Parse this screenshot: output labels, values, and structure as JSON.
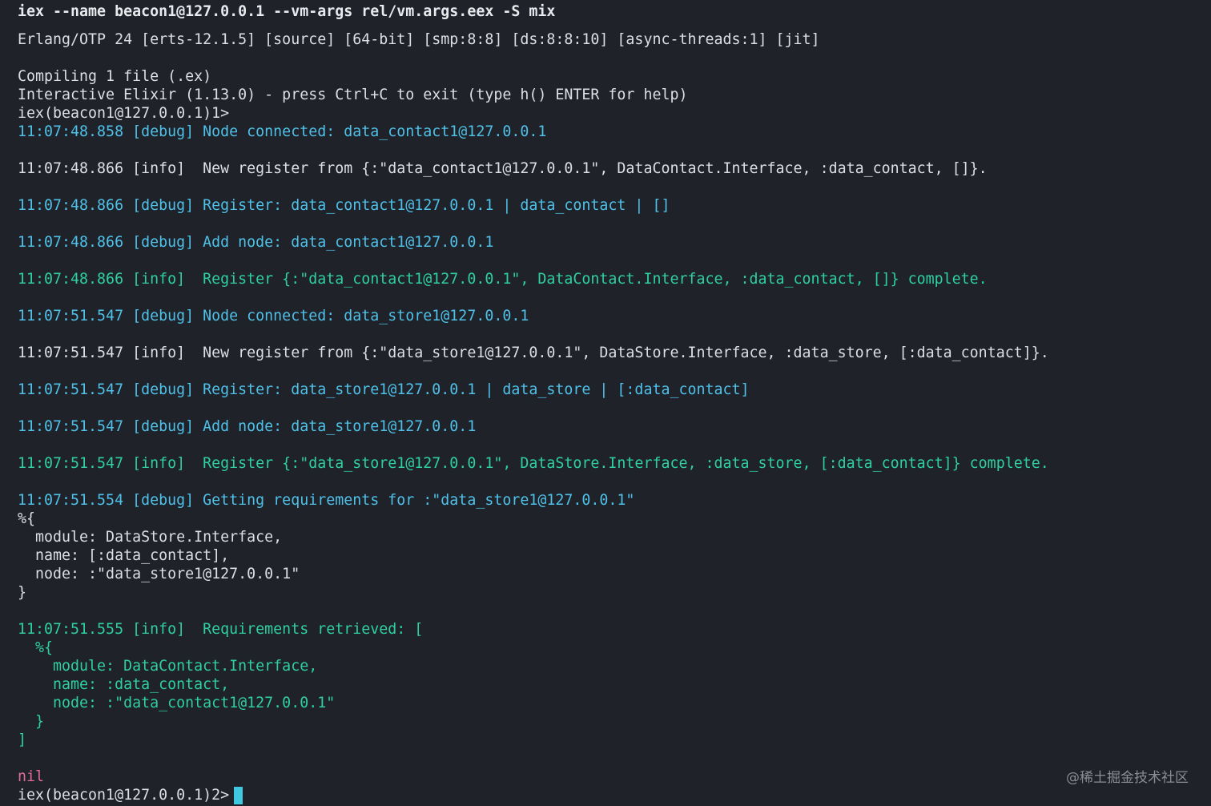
{
  "terminal": {
    "command": "iex --name beacon1@127.0.0.1 --vm-args rel/vm.args.eex -S mix",
    "lines": [
      "Erlang/OTP 24 [erts-12.1.5] [source] [64-bit] [smp:8:8] [ds:8:8:10] [async-threads:1] [jit]",
      "Compiling 1 file (.ex)",
      "Interactive Elixir (1.13.0) - press Ctrl+C to exit (type h() ENTER for help)",
      "iex(beacon1@127.0.0.1)1>",
      "11:07:48.858 [debug] Node connected: data_contact1@127.0.0.1",
      "11:07:48.866 [info]  New register from {:\"data_contact1@127.0.0.1\", DataContact.Interface, :data_contact, []}.",
      "11:07:48.866 [debug] Register: data_contact1@127.0.0.1 | data_contact | []",
      "11:07:48.866 [debug] Add node: data_contact1@127.0.0.1",
      "11:07:48.866 [info]  Register {:\"data_contact1@127.0.0.1\", DataContact.Interface, :data_contact, []} complete.",
      "11:07:51.547 [debug] Node connected: data_store1@127.0.0.1",
      "11:07:51.547 [info]  New register from {:\"data_store1@127.0.0.1\", DataStore.Interface, :data_store, [:data_contact]}.",
      "11:07:51.547 [debug] Register: data_store1@127.0.0.1 | data_store | [:data_contact]",
      "11:07:51.547 [debug] Add node: data_store1@127.0.0.1",
      "11:07:51.547 [info]  Register {:\"data_store1@127.0.0.1\", DataStore.Interface, :data_store, [:data_contact]} complete.",
      "11:07:51.554 [debug] Getting requirements for :\"data_store1@127.0.0.1\"",
      "%{",
      "  module: DataStore.Interface,",
      "  name: [:data_contact],",
      "  node: :\"data_store1@127.0.0.1\"",
      "}",
      "11:07:51.555 [info]  Requirements retrieved: [",
      "  %{",
      "    module: DataContact.Interface,",
      "    name: :data_contact,",
      "    node: :\"data_contact1@127.0.0.1\"",
      "  }",
      "]",
      "nil",
      "iex(beacon1@127.0.0.1)2> "
    ]
  },
  "watermark": "@稀土掘金技术社区",
  "colors": {
    "background": "#1f2229",
    "plain": "#dcdfe4",
    "debug": "#4fc1e9",
    "info": "#2fd0a0",
    "nil": "#e06c9f",
    "cursor": "#3fc8e0"
  }
}
